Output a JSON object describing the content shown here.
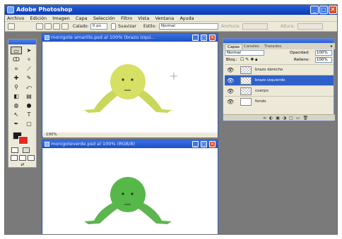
{
  "app": {
    "title": "Adobe Photoshop"
  },
  "menu": [
    "Archivo",
    "Edición",
    "Imagen",
    "Capa",
    "Selección",
    "Filtro",
    "Vista",
    "Ventana",
    "Ayuda"
  ],
  "options": {
    "feather_label": "Calado:",
    "feather_value": "0 px",
    "smooth_label": "Suavizar",
    "style_label": "Estilo:",
    "style_value": "Normal",
    "width_label": "Anchura:",
    "height_label": "Altura:"
  },
  "documents": [
    {
      "title": "monigote amarillo.psd al 100% (brazo izqui...",
      "zoom": "100%",
      "figure_color": "#d6e063",
      "limb_color": "#c9d85a"
    },
    {
      "title": "monigoteverde.psd al 100% (RGB/8)",
      "zoom": "100%",
      "figure_color": "#57b84a",
      "limb_color": "#5cb54e"
    }
  ],
  "layers_panel": {
    "tabs": [
      "Capas",
      "Canales",
      "Trazados"
    ],
    "blend_mode": "Normal",
    "opacity_label": "Opacidad:",
    "opacity_value": "100%",
    "lock_label": "Bloq.:",
    "fill_label": "Relleno:",
    "fill_value": "100%",
    "layers": [
      {
        "name": "brazo derecho",
        "selected": false
      },
      {
        "name": "brazo izquierdo",
        "selected": true
      },
      {
        "name": "cuerpo",
        "selected": false
      },
      {
        "name": "fondo",
        "selected": false
      }
    ]
  },
  "colors": {
    "foreground": "#1a1a1a",
    "background": "#e62a20",
    "title_bar": "#1448c6",
    "accent": "#2f60c8"
  }
}
